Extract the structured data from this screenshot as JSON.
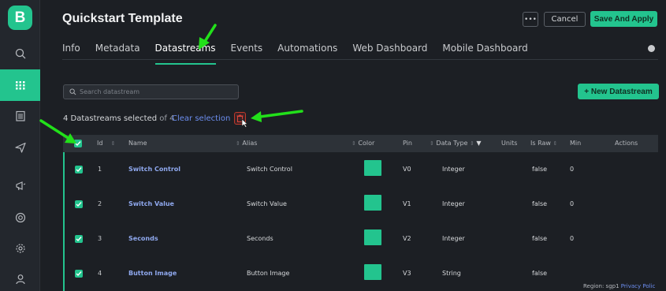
{
  "app": {
    "logo_letter": "B",
    "title": "Quickstart Template"
  },
  "header": {
    "more_label": "•••",
    "cancel_label": "Cancel",
    "save_label": "Save And Apply"
  },
  "sidebar": {
    "items": [
      {
        "icon": "search-icon"
      },
      {
        "icon": "grid-icon",
        "active": true
      },
      {
        "icon": "building-icon"
      },
      {
        "icon": "send-icon"
      },
      {
        "icon": "megaphone-icon"
      },
      {
        "icon": "lifebuoy-icon"
      },
      {
        "icon": "gear-icon"
      },
      {
        "icon": "user-icon"
      }
    ]
  },
  "tabs": [
    {
      "label": "Info"
    },
    {
      "label": "Metadata"
    },
    {
      "label": "Datastreams",
      "active": true
    },
    {
      "label": "Events"
    },
    {
      "label": "Automations"
    },
    {
      "label": "Web Dashboard"
    },
    {
      "label": "Mobile Dashboard"
    }
  ],
  "search": {
    "placeholder": "Search datastream"
  },
  "new_button": {
    "label": "+ New Datastream"
  },
  "selection": {
    "count_text": "4 Datastreams selected",
    "of_text": "of 4",
    "clear_label": "Clear selection"
  },
  "table": {
    "headers": {
      "id": "Id",
      "name": "Name",
      "alias": "Alias",
      "color": "Color",
      "pin": "Pin",
      "data_type": "Data Type",
      "units": "Units",
      "is_raw": "Is Raw",
      "min": "Min",
      "actions": "Actions"
    },
    "rows": [
      {
        "id": "1",
        "name": "Switch Control",
        "alias": "Switch Control",
        "pin": "V0",
        "data_type": "Integer",
        "is_raw": "false",
        "min": "0"
      },
      {
        "id": "2",
        "name": "Switch Value",
        "alias": "Switch Value",
        "pin": "V1",
        "data_type": "Integer",
        "is_raw": "false",
        "min": "0"
      },
      {
        "id": "3",
        "name": "Seconds",
        "alias": "Seconds",
        "pin": "V2",
        "data_type": "Integer",
        "is_raw": "false",
        "min": "0"
      },
      {
        "id": "4",
        "name": "Button Image",
        "alias": "Button Image",
        "pin": "V3",
        "data_type": "String",
        "is_raw": "false",
        "min": ""
      }
    ]
  },
  "footer": {
    "region_text": "Region: sgp1",
    "privacy_label": "Privacy Polic"
  },
  "colors": {
    "accent": "#23c48e",
    "link": "#6c8ef0",
    "danger": "#c0392b",
    "annotation_arrow": "#22e01a"
  }
}
